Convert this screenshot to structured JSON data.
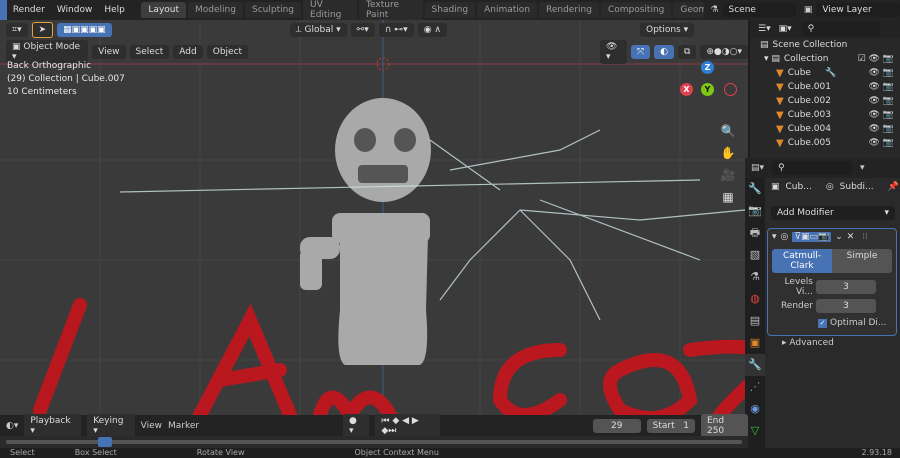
{
  "topbar": {
    "menus": [
      "Render",
      "Window",
      "Help"
    ],
    "tabs": [
      "Layout",
      "Modeling",
      "Sculpting",
      "UV Editing",
      "Texture Paint",
      "Shading",
      "Animation",
      "Rendering",
      "Compositing",
      "Geome"
    ],
    "scene": "Scene",
    "view_layer": "View Layer"
  },
  "viewport": {
    "transform_orientation": "Global",
    "mode": "Object Mode",
    "menus": [
      "View",
      "Select",
      "Add",
      "Object"
    ],
    "options": "Options",
    "overlay": [
      "Back Orthographic",
      "(29) Collection | Cube.007",
      "10 Centimeters"
    ],
    "gizmo": {
      "z": "Z",
      "x": "X",
      "y": "Y"
    }
  },
  "outliner": {
    "root": "Scene Collection",
    "collection": "Collection",
    "items": [
      "Cube",
      "Cube.001",
      "Cube.002",
      "Cube.003",
      "Cube.004",
      "Cube.005"
    ]
  },
  "properties": {
    "object": "Cub...",
    "modifier": "Subdi...",
    "add_modifier": "Add Modifier",
    "subdiv_types": [
      "Catmull-Clark",
      "Simple"
    ],
    "levels_label": "Levels Vi...",
    "levels_value": "3",
    "render_label": "Render",
    "render_value": "3",
    "optimal": "Optimal Di...",
    "advanced": "Advanced"
  },
  "timeline": {
    "menus": [
      "Playback",
      "Keying",
      "View",
      "Marker"
    ],
    "current_frame": "29",
    "start_label": "Start",
    "start": "1",
    "end_label": "End",
    "end": "250"
  },
  "status": {
    "items": [
      "Select",
      "Box Select",
      "Rotate View",
      "Object Context Menu"
    ],
    "version": "2.93.18"
  },
  "colors": {
    "accent": "#4772b3",
    "x": "#e0404f",
    "y": "#7ec814",
    "z": "#2e7fd8"
  }
}
